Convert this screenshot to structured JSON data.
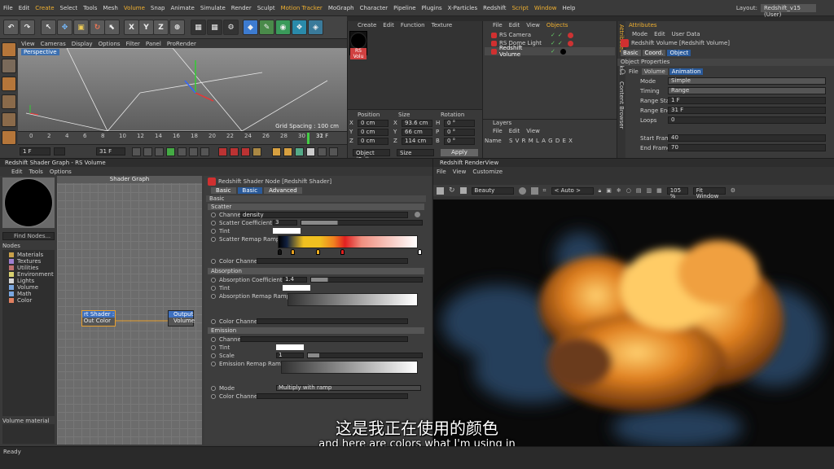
{
  "menu": {
    "items": [
      "File",
      "Edit",
      "Create",
      "Select",
      "Tools",
      "Mesh",
      "Volume",
      "Snap",
      "Animate",
      "Simulate",
      "Render",
      "Sculpt",
      "Motion Tracker",
      "MoGraph",
      "Character",
      "Pipeline",
      "Plugins",
      "X-Particles",
      "Redshift",
      "Script",
      "Window",
      "Help"
    ],
    "layout_label": "Layout:",
    "layout_value": "Redshift_v15 (User)"
  },
  "toolbar": {
    "x": "X",
    "y": "Y",
    "z": "Z"
  },
  "viewport": {
    "menu": [
      "View",
      "Cameras",
      "Display",
      "Options",
      "Filter",
      "Panel",
      "ProRender"
    ],
    "label": "Perspective",
    "grid": "Grid Spacing : 100 cm"
  },
  "timeline": {
    "ticks": [
      "0",
      "2",
      "4",
      "6",
      "8",
      "10",
      "12",
      "14",
      "16",
      "18",
      "20",
      "22",
      "24",
      "26",
      "28",
      "30",
      "32"
    ],
    "current": "31 F",
    "start": "1 F",
    "start2": "1 F",
    "end": "31 F",
    "end2": "31 F"
  },
  "materials": {
    "menu": [
      "Create",
      "Edit",
      "Function",
      "Texture"
    ],
    "mat_name": "RS Volu",
    "coord_headers": [
      "Position",
      "Size",
      "Rotation"
    ],
    "rows": [
      [
        "X",
        "0 cm",
        "X",
        "93.6 cm",
        "H",
        "0 °"
      ],
      [
        "Y",
        "0 cm",
        "Y",
        "66 cm",
        "P",
        "0 °"
      ],
      [
        "Z",
        "0 cm",
        "Z",
        "114 cm",
        "B",
        "0 °"
      ]
    ],
    "mode1": "Object (Rel)",
    "mode2": "Size",
    "apply": "Apply"
  },
  "objects": {
    "menu": [
      "File",
      "Edit",
      "View",
      "Objects"
    ],
    "items": [
      "RS Camera",
      "RS Dome Light",
      "Redshift Volume"
    ]
  },
  "layers": {
    "title": "Layers",
    "menu": [
      "File",
      "Edit",
      "View"
    ],
    "name": "Name",
    "cols": "S V R M L A G D E X"
  },
  "attributes": {
    "title": "Attributes",
    "menu": [
      "Mode",
      "Edit",
      "User Data"
    ],
    "object_title": "Redshift Volume [Redshift Volume]",
    "tabs": [
      "Basic",
      "Coord.",
      "Object"
    ],
    "section": "Object Properties",
    "file_label": "File",
    "subtabs": [
      "Volume",
      "Animation"
    ],
    "rows": [
      {
        "label": "Mode",
        "value": "Simple"
      },
      {
        "label": "Timing",
        "value": "Range"
      },
      {
        "label": "Range Start",
        "value": "1 F"
      },
      {
        "label": "Range End",
        "value": "31 F"
      },
      {
        "label": "Loops",
        "value": "0"
      },
      {
        "label": "Start Frame",
        "value": "40"
      },
      {
        "label": "End Frame",
        "value": "70"
      }
    ],
    "side_tabs": [
      "Attributes",
      "Takes",
      "Content Browser"
    ]
  },
  "graph": {
    "title": "Redshift Shader Graph - RS Volume",
    "menu": [
      "Edit",
      "Tools",
      "Options"
    ],
    "area_title": "Shader Graph",
    "find": "Find Nodes...",
    "nodes_title": "Nodes",
    "categories": [
      "Materials",
      "Textures",
      "Utilities",
      "Environment",
      "Lights",
      "Volume",
      "Math",
      "Color"
    ],
    "cat_colors": [
      "#c9a04a",
      "#9f7fd0",
      "#c07070",
      "#d8d070",
      "#d6d6d6",
      "#7aa7e0",
      "#7aa7e0",
      "#e08060"
    ],
    "node1": {
      "title": "rt Shader :",
      "port": "Out Color"
    },
    "node2": {
      "title": "Output",
      "port": "Volume"
    },
    "footer": "Volume material"
  },
  "shader": {
    "title": "Redshift Shader Node [Redshift Shader]",
    "tabs": [
      "Basic",
      "Basic",
      "Advanced"
    ],
    "basic": "Basic",
    "scatter": {
      "title": "Scatter",
      "channel_label": "Channel",
      "channel_value": "density",
      "coef_label": "Scatter Coefficient",
      "coef_value": "3",
      "tint": "Tint",
      "ramp": "Scatter Remap Ramp",
      "color_channel": "Color Channel"
    },
    "absorption": {
      "title": "Absorption",
      "coef_label": "Absorption Coefficient",
      "coef_value": "1.4",
      "tint": "Tint",
      "ramp": "Absorption Remap Ramp",
      "color_channel": "Color Channel"
    },
    "emission": {
      "title": "Emission",
      "channel": "Channel",
      "tint": "Tint",
      "scale_label": "Scale",
      "scale_value": "1",
      "ramp": "Emission Remap Ramp",
      "mode_label": "Mode",
      "mode_value": "Multiply with ramp",
      "color_channel": "Color Channel"
    }
  },
  "render": {
    "title": "Redshift RenderView",
    "menu": [
      "File",
      "View",
      "Customize"
    ],
    "beauty": "Beauty",
    "auto": "< Auto >",
    "zoom": "105 %",
    "fit": "Fit Window"
  },
  "status": {
    "text": "Ready"
  },
  "subtitles": {
    "zh": "这是我正在使用的颜色",
    "en": "and here are colors what I'm using in"
  }
}
